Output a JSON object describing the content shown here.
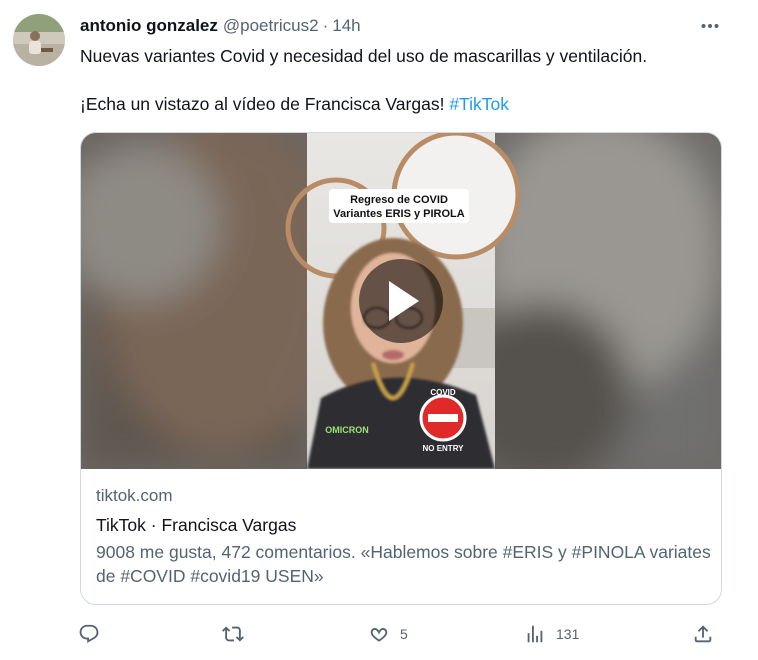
{
  "tweet": {
    "author_name": "antonio gonzalez",
    "author_handle": "@poetricus2",
    "separator": "·",
    "time": "14h",
    "text_line1": "Nuevas variantes Covid y necesidad del uso de mascarillas y ventilación.",
    "text_line2": "¡Echa un vistazo al vídeo de Francisca Vargas! ",
    "hashtag": "#TikTok"
  },
  "card": {
    "overlay_line1": "Regreso de COVID",
    "overlay_line2": "Variantes ERIS y PIROLA",
    "shirt_text": "OMICRON",
    "sticker_text_top": "COVID",
    "sticker_text_bottom": "NO ENTRY",
    "domain": "tiktok.com",
    "title": "TikTok · Francisca Vargas",
    "description": "9008 me gusta, 472 comentarios. «Hablemos sobre #ERIS y #PINOLA variates de #COVID #covid19 USEN»"
  },
  "actions": {
    "reply_count": "",
    "retweet_count": "",
    "like_count": "5",
    "views_count": "131"
  },
  "icons": {
    "more": "more-horizontal-icon",
    "reply": "reply-icon",
    "retweet": "retweet-icon",
    "like": "heart-icon",
    "views": "views-icon",
    "share": "share-icon",
    "play": "play-icon"
  },
  "colors": {
    "link": "#1d9bf0",
    "secondary_text": "#536471",
    "border": "#cfd9de"
  }
}
